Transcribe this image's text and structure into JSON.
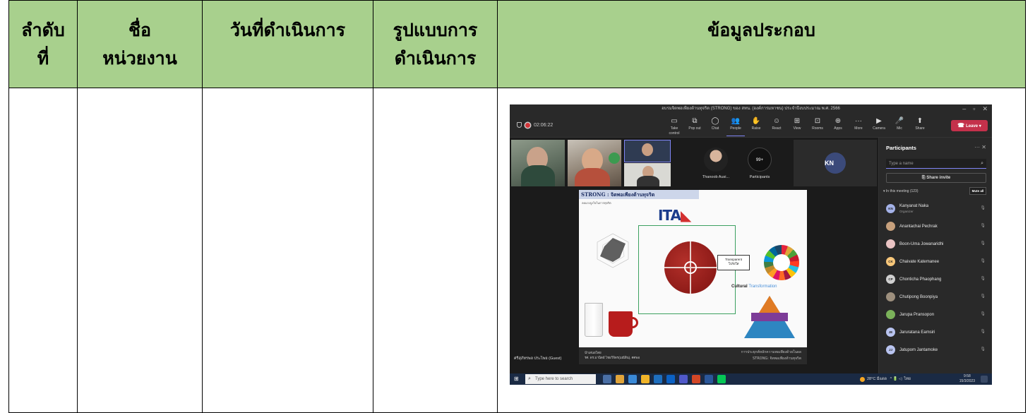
{
  "table": {
    "headers": [
      "ลำดับ\nที่",
      "ชื่อ\nหน่วยงาน",
      "วันที่ดำเนินการ",
      "รูปแบบการ\nดำเนินการ",
      "ข้อมูลประกอบ"
    ],
    "header_bg": "#a8d08d"
  },
  "teams": {
    "window_title": "อบรมจิตพอเพียงต้านทุจริต (STRONG) ของ สทน. (องค์การมหาชน) ประจำปีงบประมาณ พ.ศ. 2566",
    "timer": "02:06:22",
    "toolbar": [
      {
        "icon": "take-control-icon",
        "glyph": "▭",
        "label": "Take control"
      },
      {
        "icon": "pop-out-icon",
        "glyph": "⧉",
        "label": "Pop out"
      },
      {
        "icon": "chat-icon",
        "glyph": "◯",
        "label": "Chat"
      },
      {
        "icon": "people-icon",
        "glyph": "👥",
        "label": "People"
      },
      {
        "icon": "raise-hand-icon",
        "glyph": "✋",
        "label": "Raise"
      },
      {
        "icon": "react-icon",
        "glyph": "☺",
        "label": "React"
      },
      {
        "icon": "view-icon",
        "glyph": "⊞",
        "label": "View"
      },
      {
        "icon": "rooms-icon",
        "glyph": "⊡",
        "label": "Rooms"
      },
      {
        "icon": "apps-icon",
        "glyph": "⊕",
        "label": "Apps"
      },
      {
        "icon": "more-icon",
        "glyph": "···",
        "label": "More"
      },
      {
        "icon": "camera-icon",
        "glyph": "▶",
        "label": "Camera"
      },
      {
        "icon": "mic-icon",
        "glyph": "🎤",
        "label": "Mic"
      },
      {
        "icon": "share-icon",
        "glyph": "⬆",
        "label": "Share"
      }
    ],
    "leave_label": "Leave",
    "speaker_name": "Thanoob Ausi...",
    "participants_count": "99+",
    "participants_label": "Participants",
    "kn_initials": "KN",
    "slide": {
      "title": "STRONG : จิตพอเพียงต้านทุจริต",
      "subtitle": "ลดแรงจูงใจในการทุจริต",
      "logo": "ITA",
      "transparent_box": "Transparent\nโปร่งใส",
      "cultural": "Cultural",
      "transformation": "Transformation",
      "footer_left_1": "นำเสนอโดย",
      "footer_left_2": "รศ. ดร.มานิตย์ ไชยวิจิตร(มณีสิน), ศศพอ",
      "footer_right_1": "การประยุกต์หลักความพอเพียงด้วยในผล",
      "footer_right_2": "STRONG: จิตพอเพียงต้านทุจริต"
    },
    "guest_label": "ศรีสุภัทรพล ประไพย (Guest)",
    "panel": {
      "title": "Participants",
      "search_placeholder": "Type a name",
      "share_invite": "Share invite",
      "section": "In this meeting (123)",
      "mute_all": "Mute all",
      "people": [
        {
          "initials": "KN",
          "name": "Kanyanat Naka",
          "role": "Organizer",
          "color": "#a4b2e8"
        },
        {
          "initials": "",
          "name": "Anantachai Pechrak",
          "role": "",
          "color": "#c7a07c"
        },
        {
          "initials": "",
          "name": "Boon-Uma Jowanaridhi",
          "role": "",
          "color": "#e9c3c3"
        },
        {
          "initials": "CK",
          "name": "Chaivate Katemanee",
          "role": "",
          "color": "#f8c77a"
        },
        {
          "initials": "CP",
          "name": "Chonticha Phaophang",
          "role": "",
          "color": "#d0d0d0"
        },
        {
          "initials": "",
          "name": "Chutipong Boonpiya",
          "role": "",
          "color": "#9d8f7d"
        },
        {
          "initials": "",
          "name": "Jarupa Pransopon",
          "role": "",
          "color": "#7bb25a"
        },
        {
          "initials": "JE",
          "name": "Jaruratana Eamsiri",
          "role": "",
          "color": "#b9c4f0"
        },
        {
          "initials": "JJ",
          "name": "Jatupom Jantamoke",
          "role": "",
          "color": "#b9c4f0"
        }
      ]
    },
    "taskbar": {
      "search_placeholder": "Type here to search",
      "weather": "28°C มีแดด",
      "time": "9:58",
      "date": "15/3/2023",
      "lang": "ไทย"
    }
  }
}
